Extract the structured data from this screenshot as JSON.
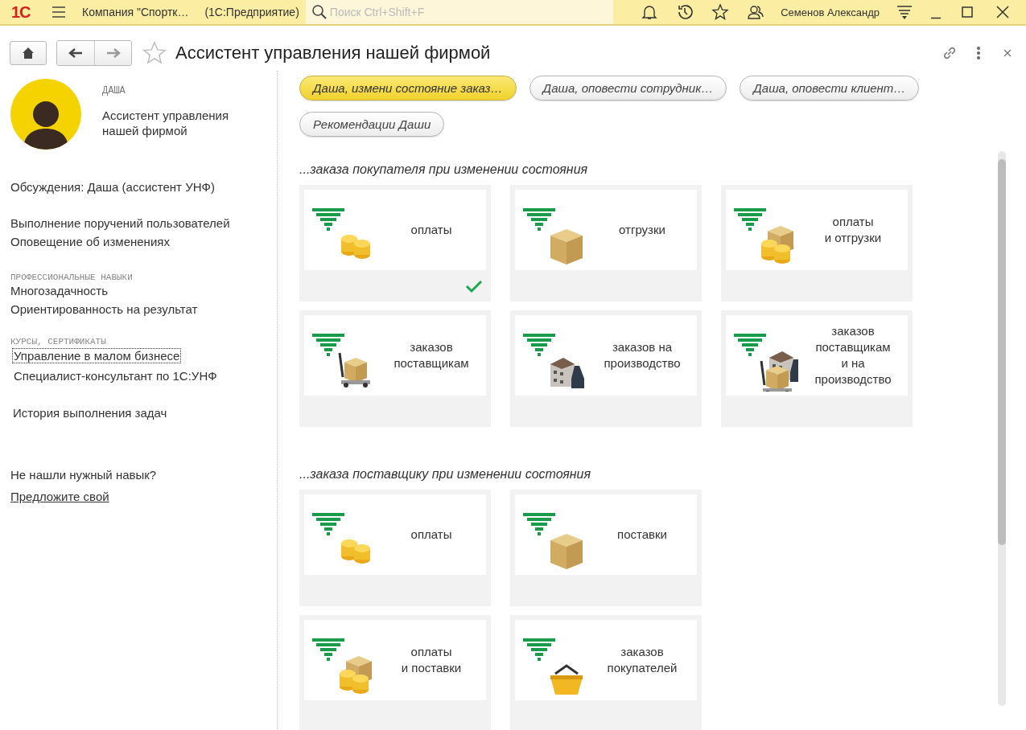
{
  "topbar": {
    "logo": "1С",
    "app_title": "Компания \"Спортк…",
    "app_subtitle": "(1С:Предприятие)",
    "search": {
      "placeholder": "Поиск Ctrl+Shift+F"
    },
    "user": "Семенов Александр"
  },
  "window": {
    "title": "Ассистент управления нашей фирмой"
  },
  "profile": {
    "name": "ДАША",
    "role": "Ассистент управления нашей фирмой",
    "discussion": "Обсуждения: Даша (ассистент УНФ)",
    "duties": [
      "Выполнение поручений пользователей",
      "Оповещение об изменениях"
    ],
    "skills_heading": "ПРОФЕССИОНАЛЬНЫЕ НАВЫКИ",
    "skills": [
      "Многозадачность",
      "Ориентированность на результат"
    ],
    "courses_heading": "КУРСЫ, СЕРТИФИКАТЫ",
    "courses": [
      {
        "label": "Управление в малом бизнесе",
        "focused": true
      },
      {
        "label": "Специалист-консультант по 1С:УНФ",
        "focused": false
      }
    ],
    "history": "История выполнения задач",
    "missing_question": "Не нашли нужный навык?",
    "suggest_link": "Предложите свой"
  },
  "chips": [
    {
      "label": "Даша, измени состояние заказ…",
      "selected": true
    },
    {
      "label": "Даша, оповести сотрудник…",
      "selected": false
    },
    {
      "label": "Даша, оповести клиент…",
      "selected": false
    },
    {
      "label": "Рекомендации Даши",
      "selected": false
    }
  ],
  "sections": [
    {
      "title": "...заказа покупателя при изменении состояния",
      "cards": [
        {
          "kind": "coins",
          "label": "оплаты",
          "checked": true
        },
        {
          "kind": "box",
          "label": "отгрузки",
          "checked": false
        },
        {
          "kind": "box-coins",
          "label": "оплаты\nи отгрузки",
          "checked": false
        },
        {
          "kind": "pallet",
          "label": "заказов\nпоставщикам",
          "checked": false
        },
        {
          "kind": "factory",
          "label": "заказов на\nпроизводство",
          "checked": false
        },
        {
          "kind": "pallet-factory",
          "label": "заказов\nпоставщикам\nи на\nпроизводство",
          "checked": false
        }
      ]
    },
    {
      "title": "...заказа поставщику при изменении состояния",
      "cards": [
        {
          "kind": "coins",
          "label": "оплаты",
          "checked": false
        },
        {
          "kind": "box",
          "label": "поставки",
          "checked": false
        },
        {
          "kind": "box-coins",
          "label": "оплаты\nи поставки",
          "checked": false
        },
        {
          "kind": "basket",
          "label": "заказов\nпокупателей",
          "checked": false
        }
      ]
    }
  ]
}
